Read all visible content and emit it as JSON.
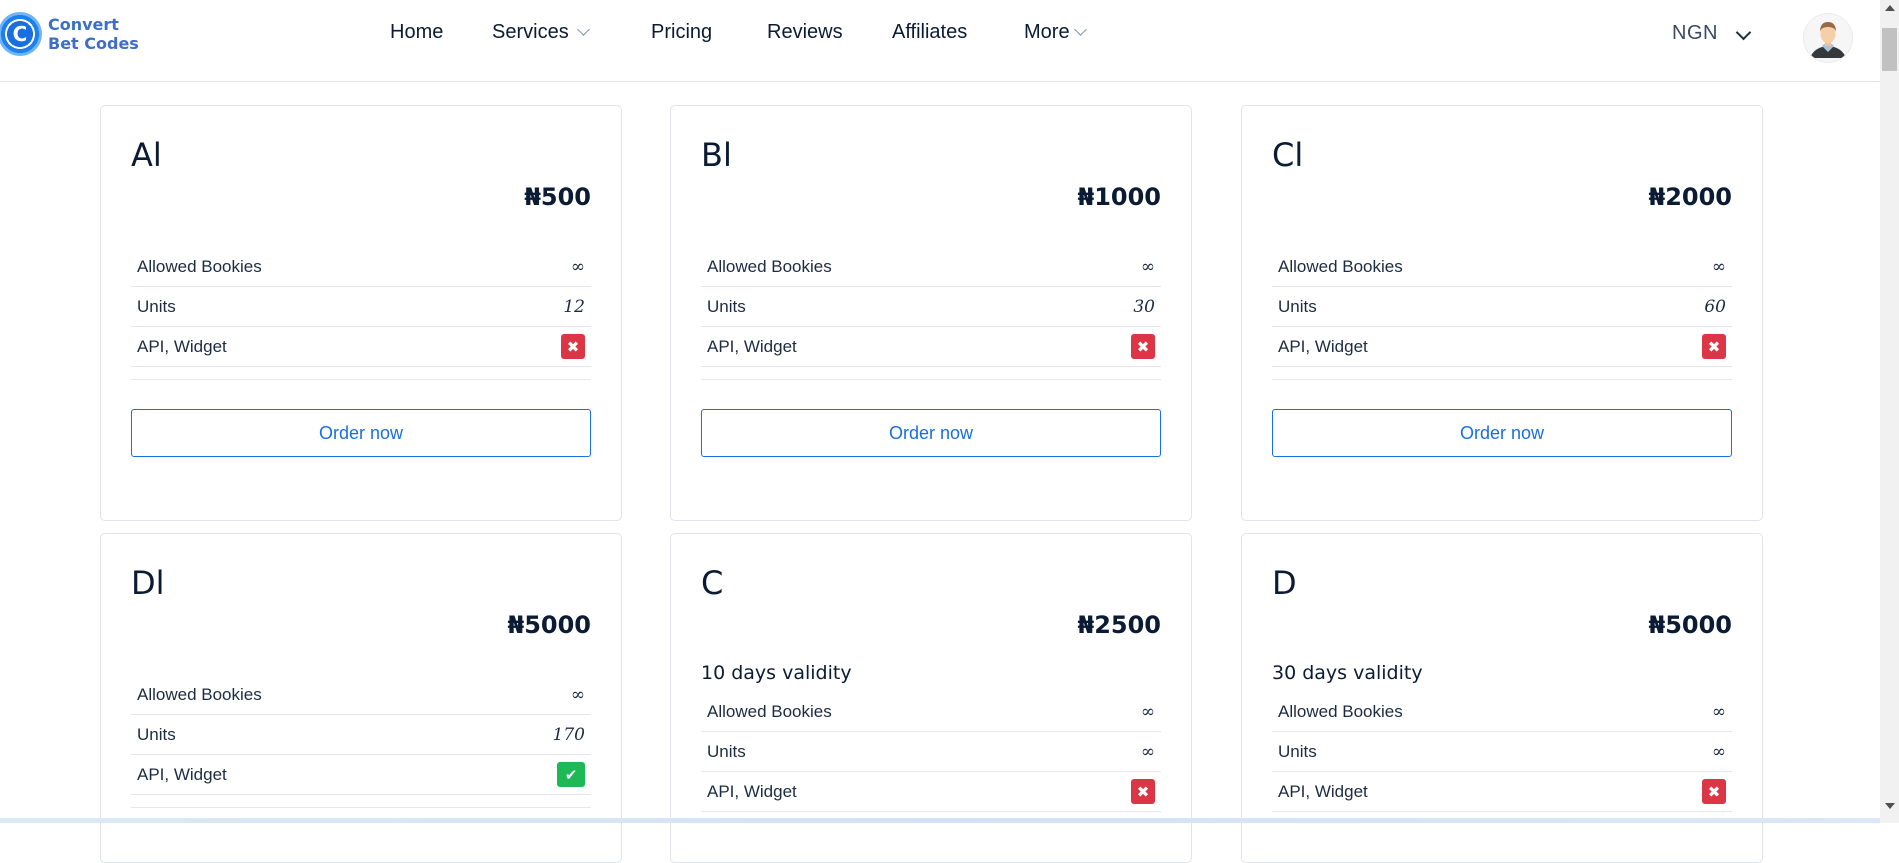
{
  "brand": {
    "line1": "Convert",
    "line2": "Bet Codes",
    "mark": "C"
  },
  "nav": [
    {
      "label": "Home",
      "dropdown": false
    },
    {
      "label": "Services",
      "dropdown": true
    },
    {
      "label": "Pricing",
      "dropdown": false
    },
    {
      "label": "Reviews",
      "dropdown": false
    },
    {
      "label": "Affiliates",
      "dropdown": false
    },
    {
      "label": "More",
      "dropdown": true
    }
  ],
  "currency": {
    "selected": "NGN"
  },
  "user": {
    "avatar_icon": "user-avatar-icon"
  },
  "colors": {
    "accent": "#1a6fe0",
    "danger": "#dc3545",
    "success": "#1db954",
    "text": "#0b1b33"
  },
  "plans": [
    {
      "name": "Al",
      "price": "₦500",
      "validity": null,
      "features": [
        {
          "label": "Allowed Bookies",
          "value": "∞"
        },
        {
          "label": "Units",
          "value": "12"
        },
        {
          "label": "API, Widget",
          "value": "✖",
          "status": "no"
        }
      ],
      "cta": "Order now"
    },
    {
      "name": "Bl",
      "price": "₦1000",
      "validity": null,
      "features": [
        {
          "label": "Allowed Bookies",
          "value": "∞"
        },
        {
          "label": "Units",
          "value": "30"
        },
        {
          "label": "API, Widget",
          "value": "✖",
          "status": "no"
        }
      ],
      "cta": "Order now"
    },
    {
      "name": "Cl",
      "price": "₦2000",
      "validity": null,
      "features": [
        {
          "label": "Allowed Bookies",
          "value": "∞"
        },
        {
          "label": "Units",
          "value": "60"
        },
        {
          "label": "API, Widget",
          "value": "✖",
          "status": "no"
        }
      ],
      "cta": "Order now"
    },
    {
      "name": "Dl",
      "price": "₦5000",
      "validity": null,
      "features": [
        {
          "label": "Allowed Bookies",
          "value": "∞"
        },
        {
          "label": "Units",
          "value": "170"
        },
        {
          "label": "API, Widget",
          "value": "✔",
          "status": "yes"
        }
      ]
    },
    {
      "name": "C",
      "price": "₦2500",
      "validity": "10 days validity",
      "features": [
        {
          "label": "Allowed Bookies",
          "value": "∞"
        },
        {
          "label": "Units",
          "value": "∞"
        },
        {
          "label": "API, Widget",
          "value": "✖",
          "status": "no"
        }
      ]
    },
    {
      "name": "D",
      "price": "₦5000",
      "validity": "30 days validity",
      "features": [
        {
          "label": "Allowed Bookies",
          "value": "∞"
        },
        {
          "label": "Units",
          "value": "∞"
        },
        {
          "label": "API, Widget",
          "value": "✖",
          "status": "no"
        }
      ]
    }
  ]
}
